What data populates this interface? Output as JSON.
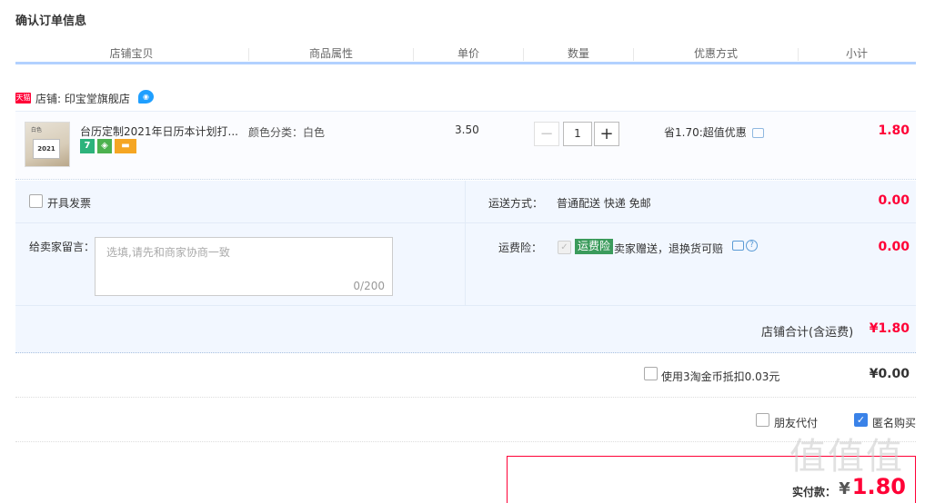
{
  "page": {
    "title": "确认订单信息"
  },
  "columns": [
    "店铺宝贝",
    "商品属性",
    "单价",
    "数量",
    "优惠方式",
    "小计"
  ],
  "shop": {
    "badge": "天猫",
    "label": "店铺: 印宝堂旗舰店"
  },
  "item": {
    "thumb_top": "白色",
    "thumb_year": "2021",
    "title": "台历定制2021年日历本计划打...",
    "service_7": "7",
    "attr": "颜色分类：白色",
    "price": "3.50",
    "qty_minus": "−",
    "qty_value": "1",
    "qty_plus": "+",
    "discount": "省1.70:超值优惠",
    "subtotal": "1.80"
  },
  "options": {
    "invoice_label": "开具发票",
    "ship_label": "运送方式：",
    "ship_value": "普通配送 快递 免邮",
    "ship_fee": "0.00",
    "memo_label": "给卖家留言：",
    "memo_placeholder": "选填,请先和商家协商一致",
    "memo_count": "0/200",
    "insure_label": "运费险：",
    "insure_badge": "运费险",
    "insure_text": "卖家赠送，退换货可赔",
    "insure_fee": "0.00",
    "shop_total_label": "店铺合计(含运费)",
    "shop_total_value": "¥1.80"
  },
  "coin": {
    "label": "使用3淘金币抵扣0.03元",
    "value": "¥0.00"
  },
  "pay": {
    "friend_label": "朋友代付",
    "anon_label": "匿名购买"
  },
  "final": {
    "label": "实付款：",
    "currency": "¥",
    "value": "1.80"
  },
  "watermark": "值值值",
  "colors": {
    "price_red": "#ff0036",
    "header_line": "#b2d1ff",
    "option_bg": "#f2f7ff",
    "checked_blue": "#3a82e8"
  }
}
